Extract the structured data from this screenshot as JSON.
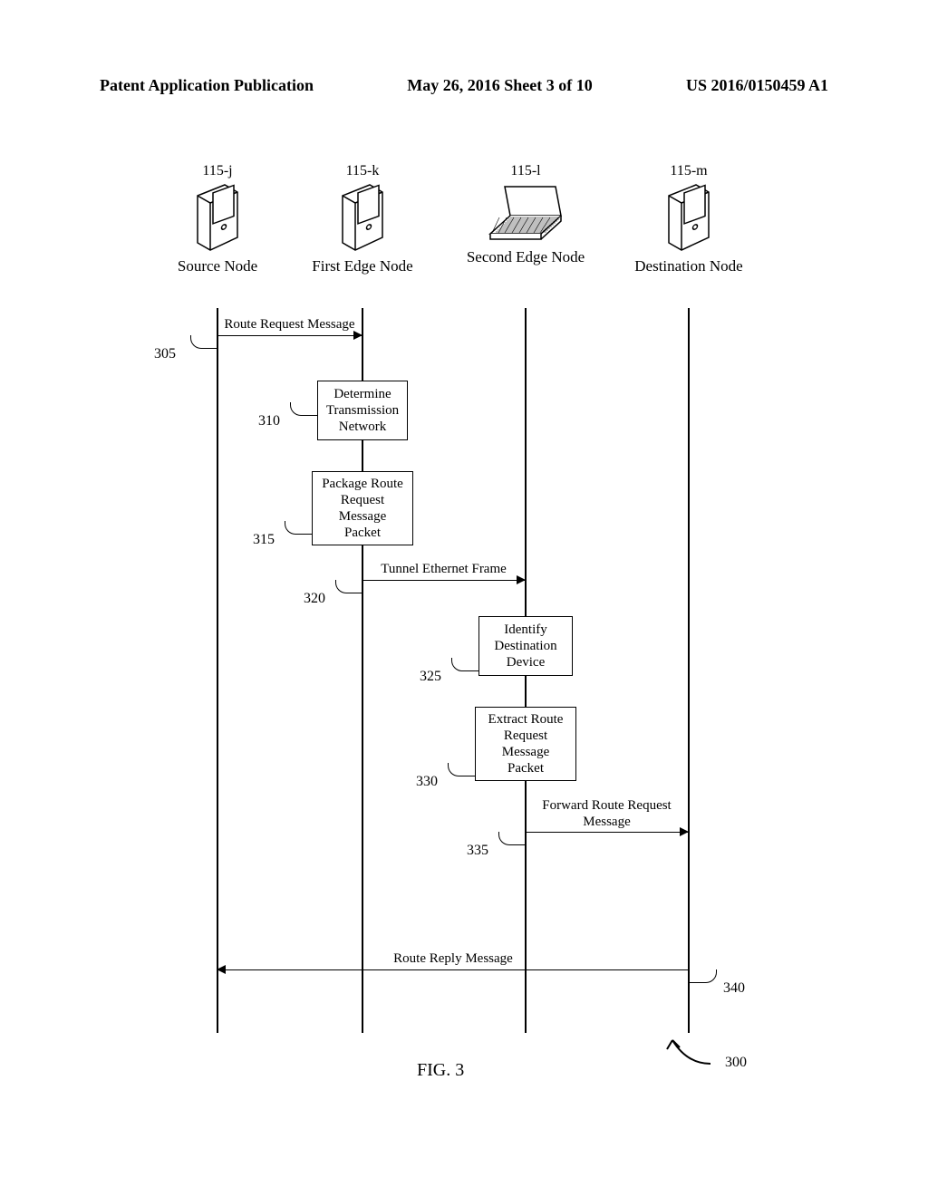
{
  "header": {
    "left": "Patent Application Publication",
    "center": "May 26, 2016  Sheet 3 of 10",
    "right": "US 2016/0150459 A1"
  },
  "lanes": {
    "source": {
      "id": "115-j",
      "role": "Source Node"
    },
    "first": {
      "id": "115-k",
      "role": "First Edge Node"
    },
    "second": {
      "id": "115-l",
      "role": "Second Edge Node"
    },
    "dest": {
      "id": "115-m",
      "role": "Destination Node"
    }
  },
  "steps": {
    "s305": {
      "num": "305",
      "label": "Route Request Message"
    },
    "s310": {
      "num": "310",
      "label": "Determine Transmission Network"
    },
    "s315": {
      "num": "315",
      "label": "Package Route Request Message Packet"
    },
    "s320": {
      "num": "320",
      "label": "Tunnel Ethernet Frame"
    },
    "s325": {
      "num": "325",
      "label": "Identify Destination Device"
    },
    "s330": {
      "num": "330",
      "label": "Extract Route Request Message Packet"
    },
    "s335": {
      "num": "335",
      "label": "Forward Route Request Message"
    },
    "s340": {
      "num": "340",
      "label": "Route Reply Message"
    }
  },
  "figure": {
    "label": "FIG. 3",
    "ref": "300"
  }
}
